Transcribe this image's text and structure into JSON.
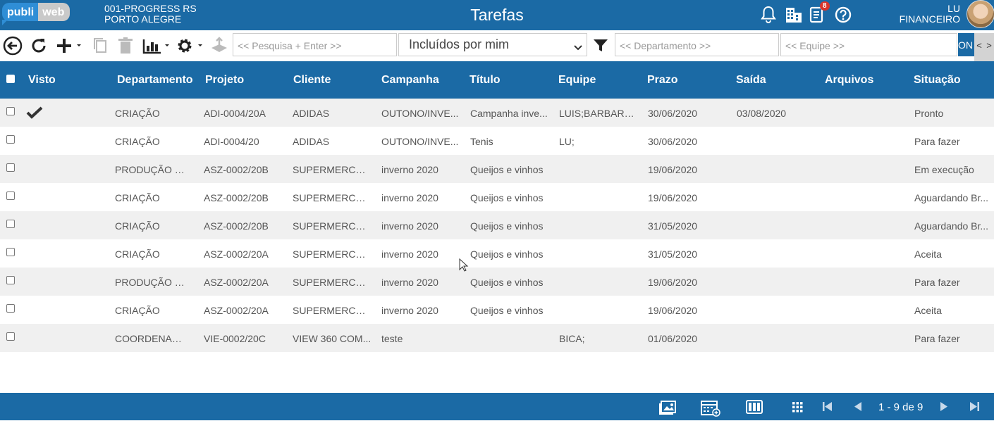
{
  "app": {
    "logo": {
      "part1": "publi",
      "part2": "web"
    },
    "company": {
      "line1": "001-PROGRESS RS",
      "line2": "PORTO ALEGRE"
    },
    "title": "Tarefas",
    "notifications_badge": "8",
    "user": {
      "name": "LU",
      "role": "FINANCEIRO"
    },
    "colors": {
      "primary": "#1b6aa5",
      "row_alt": "#f0f0f0",
      "badge": "#d9342b"
    }
  },
  "toolbar": {
    "icons": [
      "back-circle-icon",
      "refresh-icon",
      "add-icon",
      "copy-icon",
      "trash-icon",
      "chart-icon",
      "gear-icon",
      "upload-icon",
      "filter-icon"
    ],
    "search_placeholder": "<< Pesquisa + Enter >>",
    "filter_select": "Incluídos por mim",
    "department_placeholder": "<< Departamento >>",
    "team_placeholder": "<< Equipe >>",
    "on_button": "ON",
    "scroll_left": "<",
    "scroll_right": ">"
  },
  "table": {
    "columns": [
      "Visto",
      "Departamento",
      "Projeto",
      "Cliente",
      "Campanha",
      "Título",
      "Equipe",
      "Prazo",
      "Saída",
      "Arquivos",
      "Situação"
    ],
    "rows": [
      {
        "seen": true,
        "departamento": "CRIAÇÃO",
        "projeto": "ADI-0004/20A",
        "cliente": "ADIDAS",
        "campanha": "OUTONO/INVE...",
        "titulo": "Campanha inve...",
        "equipe": "LUIS;BARBARA;...",
        "prazo": "30/06/2020",
        "saida": "03/08/2020",
        "arquivos": "",
        "situacao": "Pronto"
      },
      {
        "seen": false,
        "departamento": "CRIAÇÃO",
        "projeto": "ADI-0004/20",
        "cliente": "ADIDAS",
        "campanha": "OUTONO/INVE...",
        "titulo": "Tenis",
        "equipe": "LU;",
        "prazo": "30/06/2020",
        "saida": "",
        "arquivos": "",
        "situacao": "Para fazer"
      },
      {
        "seen": false,
        "departamento": "PRODUÇÃO G...",
        "projeto": "ASZ-0002/20B",
        "cliente": "SUPERMERCAD...",
        "campanha": "inverno 2020",
        "titulo": "Queijos e vinhos",
        "equipe": "",
        "prazo": "19/06/2020",
        "saida": "",
        "arquivos": "",
        "situacao": "Em execução"
      },
      {
        "seen": false,
        "departamento": "CRIAÇÃO",
        "projeto": "ASZ-0002/20B",
        "cliente": "SUPERMERCAD...",
        "campanha": "inverno 2020",
        "titulo": "Queijos e vinhos",
        "equipe": "",
        "prazo": "19/06/2020",
        "saida": "",
        "arquivos": "",
        "situacao": "Aguardando Br..."
      },
      {
        "seen": false,
        "departamento": "CRIAÇÃO",
        "projeto": "ASZ-0002/20B",
        "cliente": "SUPERMERCAD...",
        "campanha": "inverno 2020",
        "titulo": "Queijos e vinhos",
        "equipe": "",
        "prazo": "31/05/2020",
        "saida": "",
        "arquivos": "",
        "situacao": "Aguardando Br..."
      },
      {
        "seen": false,
        "departamento": "CRIAÇÃO",
        "projeto": "ASZ-0002/20A",
        "cliente": "SUPERMERCAD...",
        "campanha": "inverno 2020",
        "titulo": "Queijos e vinhos",
        "equipe": "",
        "prazo": "31/05/2020",
        "saida": "",
        "arquivos": "",
        "situacao": "Aceita"
      },
      {
        "seen": false,
        "departamento": "PRODUÇÃO G...",
        "projeto": "ASZ-0002/20A",
        "cliente": "SUPERMERCAD...",
        "campanha": "inverno 2020",
        "titulo": "Queijos e vinhos",
        "equipe": "",
        "prazo": "19/06/2020",
        "saida": "",
        "arquivos": "",
        "situacao": "Para fazer"
      },
      {
        "seen": false,
        "departamento": "CRIAÇÃO",
        "projeto": "ASZ-0002/20A",
        "cliente": "SUPERMERCAD...",
        "campanha": "inverno 2020",
        "titulo": "Queijos e vinhos",
        "equipe": "",
        "prazo": "19/06/2020",
        "saida": "",
        "arquivos": "",
        "situacao": "Aceita"
      },
      {
        "seen": false,
        "departamento": "COORDENAÇÃO",
        "projeto": "VIE-0002/20C",
        "cliente": "VIEW 360 COM...",
        "campanha": "teste",
        "titulo": "",
        "equipe": "BICA;",
        "prazo": "01/06/2020",
        "saida": "",
        "arquivos": "",
        "situacao": "Para fazer"
      }
    ]
  },
  "footer": {
    "icons": [
      "gallery-icon",
      "calendar-add-icon",
      "columns-icon",
      "grid-icon",
      "first-page-icon",
      "prev-page-icon",
      "next-page-icon",
      "last-page-icon"
    ],
    "pager": "1 - 9 de 9"
  }
}
